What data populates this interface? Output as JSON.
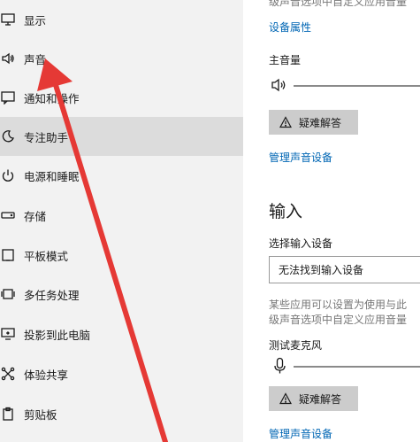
{
  "sidebar": {
    "items": [
      {
        "label": "显示",
        "icon": "display-icon"
      },
      {
        "label": "声音",
        "icon": "speaker-icon"
      },
      {
        "label": "通知和操作",
        "icon": "notification-icon"
      },
      {
        "label": "专注助手",
        "icon": "moon-icon",
        "active": true
      },
      {
        "label": "电源和睡眠",
        "icon": "power-icon"
      },
      {
        "label": "存储",
        "icon": "storage-icon"
      },
      {
        "label": "平板模式",
        "icon": "tablet-icon"
      },
      {
        "label": "多任务处理",
        "icon": "multitask-icon"
      },
      {
        "label": "投影到此电脑",
        "icon": "project-icon"
      },
      {
        "label": "体验共享",
        "icon": "share-icon"
      },
      {
        "label": "剪贴板",
        "icon": "clipboard-icon"
      }
    ]
  },
  "output": {
    "top_cut_text": "级声音选项中自定义应用音量",
    "device_properties_link": "设备属性",
    "master_volume_label": "主音量",
    "troubleshoot_label": "疑难解答",
    "manage_devices_link": "管理声音设备"
  },
  "input": {
    "heading": "输入",
    "select_device_label": "选择输入设备",
    "select_value": "无法找到输入设备",
    "info_line1": "某些应用可以设置为使用与此",
    "info_line2": "级声音选项中自定义应用音量",
    "test_mic_label": "测试麦克风",
    "troubleshoot_label": "疑难解答",
    "manage_devices_link": "管理声音设备"
  },
  "colors": {
    "link": "#0066b4",
    "arrow": "#e53935",
    "sidebar_bg": "#f2f2f2",
    "active_bg": "#dcdcdc",
    "button_bg": "#cccccc"
  }
}
